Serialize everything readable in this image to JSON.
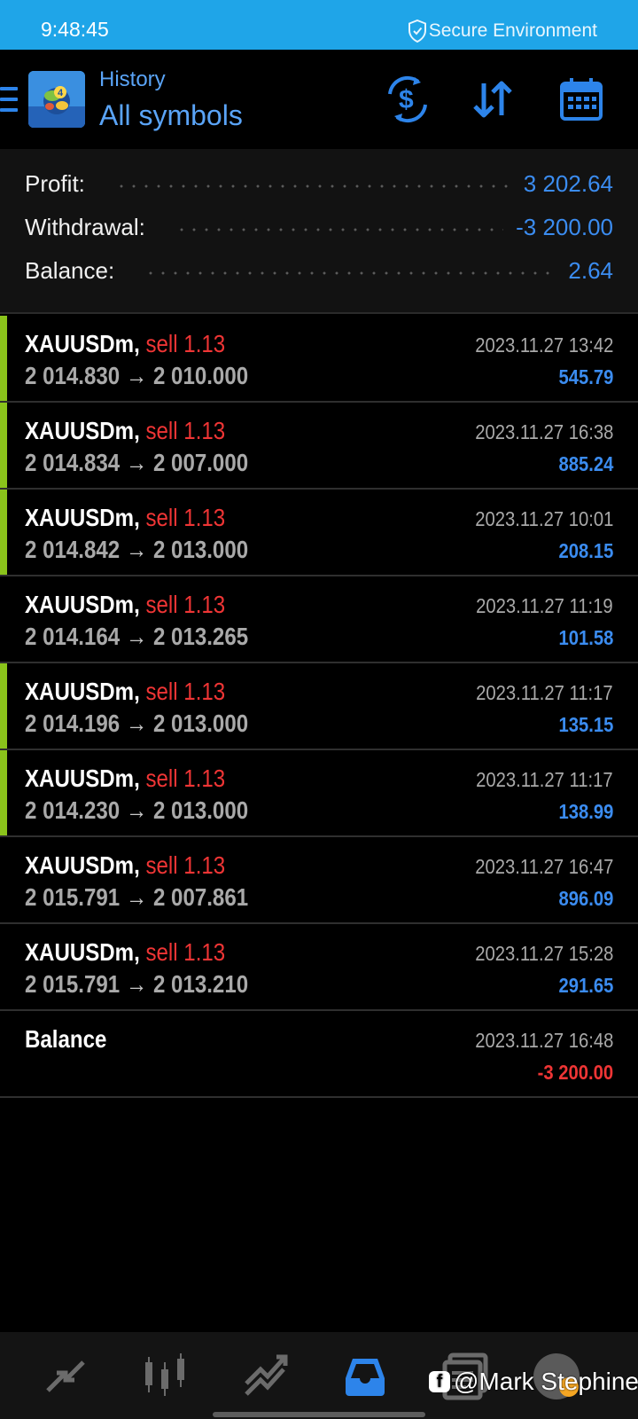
{
  "status_bar": {
    "time": "9:48:45",
    "secure_label": "Secure Environment",
    "background": "#1fa5e8"
  },
  "header": {
    "subtitle": "History",
    "title": "All symbols",
    "accent": "#5aa4f7",
    "icons": [
      "menu-icon",
      "app-logo-icon",
      "currency-exchange-icon",
      "sort-icon",
      "calendar-icon"
    ]
  },
  "summary": {
    "profit_label": "Profit:",
    "profit_value": "3 202.64",
    "withdrawal_label": "Withdrawal:",
    "withdrawal_value": "-3 200.00",
    "balance_label": "Balance:",
    "balance_value": "2.64",
    "value_color": "#3b8cf0"
  },
  "deals": [
    {
      "symbol": "XAUUSDm,",
      "type": "sell 1.13",
      "open": "2 014.830",
      "arrow": "→",
      "close": "2 010.000",
      "time": "2023.11.27 13:42",
      "profit": "545.79",
      "bar": true
    },
    {
      "symbol": "XAUUSDm,",
      "type": "sell 1.13",
      "open": "2 014.834",
      "arrow": "→",
      "close": "2 007.000",
      "time": "2023.11.27 16:38",
      "profit": "885.24",
      "bar": true
    },
    {
      "symbol": "XAUUSDm,",
      "type": "sell 1.13",
      "open": "2 014.842",
      "arrow": "→",
      "close": "2 013.000",
      "time": "2023.11.27 10:01",
      "profit": "208.15",
      "bar": true
    },
    {
      "symbol": "XAUUSDm,",
      "type": "sell 1.13",
      "open": "2 014.164",
      "arrow": "→",
      "close": "2 013.265",
      "time": "2023.11.27 11:19",
      "profit": "101.58",
      "bar": false
    },
    {
      "symbol": "XAUUSDm,",
      "type": "sell 1.13",
      "open": "2 014.196",
      "arrow": "→",
      "close": "2 013.000",
      "time": "2023.11.27 11:17",
      "profit": "135.15",
      "bar": true
    },
    {
      "symbol": "XAUUSDm,",
      "type": "sell 1.13",
      "open": "2 014.230",
      "arrow": "→",
      "close": "2 013.000",
      "time": "2023.11.27 11:17",
      "profit": "138.99",
      "bar": true
    },
    {
      "symbol": "XAUUSDm,",
      "type": "sell 1.13",
      "open": "2 015.791",
      "arrow": "→",
      "close": "2 007.861",
      "time": "2023.11.27 16:47",
      "profit": "896.09",
      "bar": false
    },
    {
      "symbol": "XAUUSDm,",
      "type": "sell 1.13",
      "open": "2 015.791",
      "arrow": "→",
      "close": "2 013.210",
      "time": "2023.11.27 15:28",
      "profit": "291.65",
      "bar": false
    }
  ],
  "balance_entry": {
    "label": "Balance",
    "time": "2023.11.27 16:48",
    "amount": "-3 200.00"
  },
  "colors": {
    "profit": "#3b8cf0",
    "loss": "#ef3535",
    "sell": "#ef3535",
    "position_bar": "#8ac31b"
  },
  "bottom_nav": {
    "items": [
      "quotes-icon",
      "chart-icon",
      "trade-icon",
      "history-icon",
      "messages-icon",
      "chat-icon"
    ],
    "active": "history-icon"
  },
  "watermark": {
    "text": "@Mark Stephine"
  }
}
